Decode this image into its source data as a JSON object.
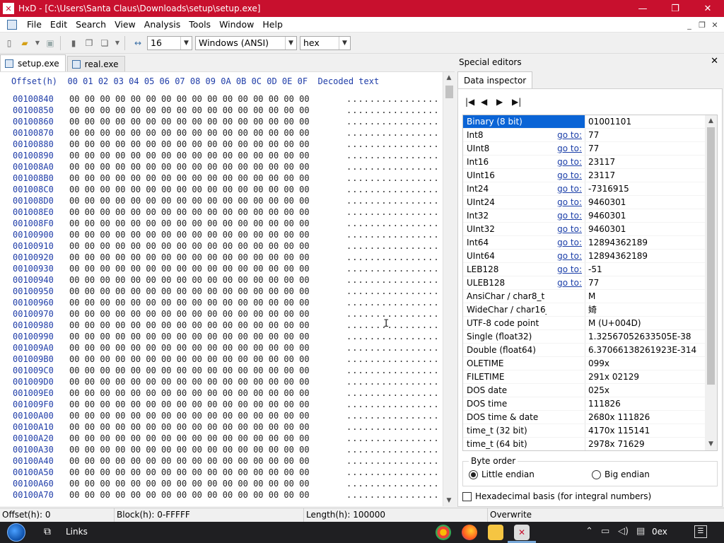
{
  "titlebar": {
    "title": "HxD - [C:\\Users\\Santa Claus\\Downloads\\setup\\setup.exe]",
    "icon": "hxd-app-icon",
    "minimize": "—",
    "maximize": "❐",
    "close": "✕"
  },
  "menubar": {
    "items": [
      "File",
      "Edit",
      "Search",
      "View",
      "Analysis",
      "Tools",
      "Window",
      "Help"
    ],
    "mdi_minimize": "_",
    "mdi_restore": "❐",
    "mdi_close": "✕"
  },
  "toolbar": {
    "bytes_per_row": "16",
    "charset": "Windows (ANSI)",
    "offset_base": "hex"
  },
  "tabs": [
    {
      "label": "setup.exe",
      "active": true
    },
    {
      "label": "real.exe",
      "active": false
    }
  ],
  "hexview": {
    "header_offset": "Offset(h)",
    "header_columns": "00 01 02 03 04 05 06 07 08 09 0A 0B 0C 0D 0E 0F",
    "header_decoded": "Decoded text",
    "row_bytes": "00 00 00 00 00 00 00 00 00 00 00 00 00 00 00 00",
    "row_text": "................",
    "offsets": [
      "00100840",
      "00100850",
      "00100860",
      "00100870",
      "00100880",
      "00100890",
      "001008A0",
      "001008B0",
      "001008C0",
      "001008D0",
      "001008E0",
      "001008F0",
      "00100900",
      "00100910",
      "00100920",
      "00100930",
      "00100940",
      "00100950",
      "00100960",
      "00100970",
      "00100980",
      "00100990",
      "001009A0",
      "001009B0",
      "001009C0",
      "001009D0",
      "001009E0",
      "001009F0",
      "00100A00",
      "00100A10",
      "00100A20",
      "00100A30",
      "00100A40",
      "00100A50",
      "00100A60",
      "00100A70"
    ]
  },
  "special_editors": {
    "title": "Special editors",
    "close": "✕",
    "tab": "Data inspector",
    "nav": [
      "first-icon",
      "prev-icon",
      "next-icon",
      "last-icon"
    ],
    "link_text": "go to:",
    "rows": [
      {
        "name": "Binary (8 bit)",
        "link": false,
        "value": "01001101",
        "selected": true
      },
      {
        "name": "Int8",
        "link": true,
        "value": "77"
      },
      {
        "name": "UInt8",
        "link": true,
        "value": "77"
      },
      {
        "name": "Int16",
        "link": true,
        "value": "23117"
      },
      {
        "name": "UInt16",
        "link": true,
        "value": "23117"
      },
      {
        "name": "Int24",
        "link": true,
        "value": "-7316915"
      },
      {
        "name": "UInt24",
        "link": true,
        "value": "9460301"
      },
      {
        "name": "Int32",
        "link": true,
        "value": "9460301"
      },
      {
        "name": "UInt32",
        "link": true,
        "value": "9460301"
      },
      {
        "name": "Int64",
        "link": true,
        "value": "12894362189"
      },
      {
        "name": "UInt64",
        "link": true,
        "value": "12894362189"
      },
      {
        "name": "LEB128",
        "link": true,
        "value": "-51"
      },
      {
        "name": "ULEB128",
        "link": true,
        "value": "77"
      },
      {
        "name": "AnsiChar / char8_t",
        "link": false,
        "value": "M"
      },
      {
        "name": "WideChar / char16_t",
        "link": false,
        "value": "婍"
      },
      {
        "name": "UTF-8 code point",
        "link": false,
        "value": "M (U+004D)"
      },
      {
        "name": "Single (float32)",
        "link": false,
        "value": "1.32567052633505E-38"
      },
      {
        "name": "Double (float64)",
        "link": false,
        "value": "6.37066138261923E-314"
      },
      {
        "name": "OLETIME",
        "link": false,
        "value": "099x"
      },
      {
        "name": "FILETIME",
        "link": false,
        "value": "291x 02129"
      },
      {
        "name": "DOS date",
        "link": false,
        "value": "025x"
      },
      {
        "name": "DOS time",
        "link": false,
        "value": "111826"
      },
      {
        "name": "DOS time & date",
        "link": false,
        "value": "2680x 111826"
      },
      {
        "name": "time_t (32 bit)",
        "link": false,
        "value": "4170x 115141"
      },
      {
        "name": "time_t (64 bit)",
        "link": false,
        "value": "2978x 71629"
      }
    ],
    "byte_order": {
      "legend": "Byte order",
      "little": "Little endian",
      "big": "Big endian",
      "selected": "little"
    },
    "hex_basis": "Hexadecimal basis (for integral numbers)"
  },
  "statusbar": {
    "offset": "Offset(h): 0",
    "block": "Block(h): 0-FFFFF",
    "length": "Length(h): 100000",
    "mode": "Overwrite"
  },
  "taskbar": {
    "links": "Links",
    "clock": "0ex",
    "apps": [
      "chrome-icon",
      "firefox-icon",
      "folder-icon",
      "hxd-icon"
    ]
  },
  "colors": {
    "titlebar": "#c8102e",
    "offset_text": "#1e3ca8",
    "selection": "#0a64d6",
    "link": "#1a3ea8"
  }
}
